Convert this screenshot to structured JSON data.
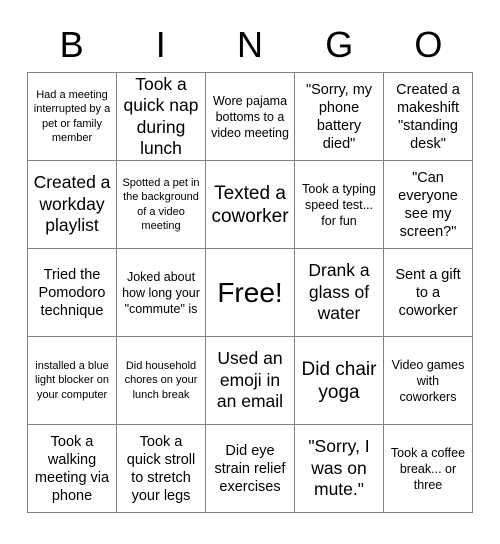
{
  "card": {
    "header_letters": [
      "B",
      "I",
      "N",
      "G",
      "O"
    ],
    "columns": 5,
    "rows": 5,
    "background_color": "#ffffff",
    "text_color": "#000000",
    "border_color": "#808080",
    "cells": [
      {
        "text": "Had a meeting interrupted by a pet or family member",
        "size": "fs-xs"
      },
      {
        "text": "Took a quick nap during lunch",
        "size": "fs-lg"
      },
      {
        "text": "Wore pajama bottoms to a video meeting",
        "size": "fs-sm"
      },
      {
        "text": "\"Sorry, my phone battery died\"",
        "size": "fs-md"
      },
      {
        "text": "Created a makeshift \"standing desk\"",
        "size": "fs-md"
      },
      {
        "text": "Created a workday playlist",
        "size": "fs-lg"
      },
      {
        "text": "Spotted a pet in the background of a video meeting",
        "size": "fs-xs"
      },
      {
        "text": "Texted a coworker",
        "size": "fs-xl"
      },
      {
        "text": "Took a typing speed test... for fun",
        "size": "fs-sm"
      },
      {
        "text": "\"Can everyone see my screen?\"",
        "size": "fs-md"
      },
      {
        "text": "Tried the Pomodoro technique",
        "size": "fs-md"
      },
      {
        "text": "Joked about how long your \"commute\" is",
        "size": "fs-sm"
      },
      {
        "text": "Free!",
        "size": "fs-free"
      },
      {
        "text": "Drank a glass of water",
        "size": "fs-lg"
      },
      {
        "text": "Sent a gift to a coworker",
        "size": "fs-md"
      },
      {
        "text": "installed a blue light blocker on your computer",
        "size": "fs-xs"
      },
      {
        "text": "Did household chores on your lunch break",
        "size": "fs-xs"
      },
      {
        "text": "Used an emoji in an email",
        "size": "fs-lg"
      },
      {
        "text": "Did chair yoga",
        "size": "fs-xl"
      },
      {
        "text": "Video games with coworkers",
        "size": "fs-sm"
      },
      {
        "text": "Took a walking meeting via phone",
        "size": "fs-md"
      },
      {
        "text": "Took a quick stroll to stretch your legs",
        "size": "fs-md"
      },
      {
        "text": "Did eye strain relief exercises",
        "size": "fs-md"
      },
      {
        "text": "\"Sorry, I was on mute.\"",
        "size": "fs-lg"
      },
      {
        "text": "Took a coffee break... or three",
        "size": "fs-sm"
      }
    ]
  }
}
